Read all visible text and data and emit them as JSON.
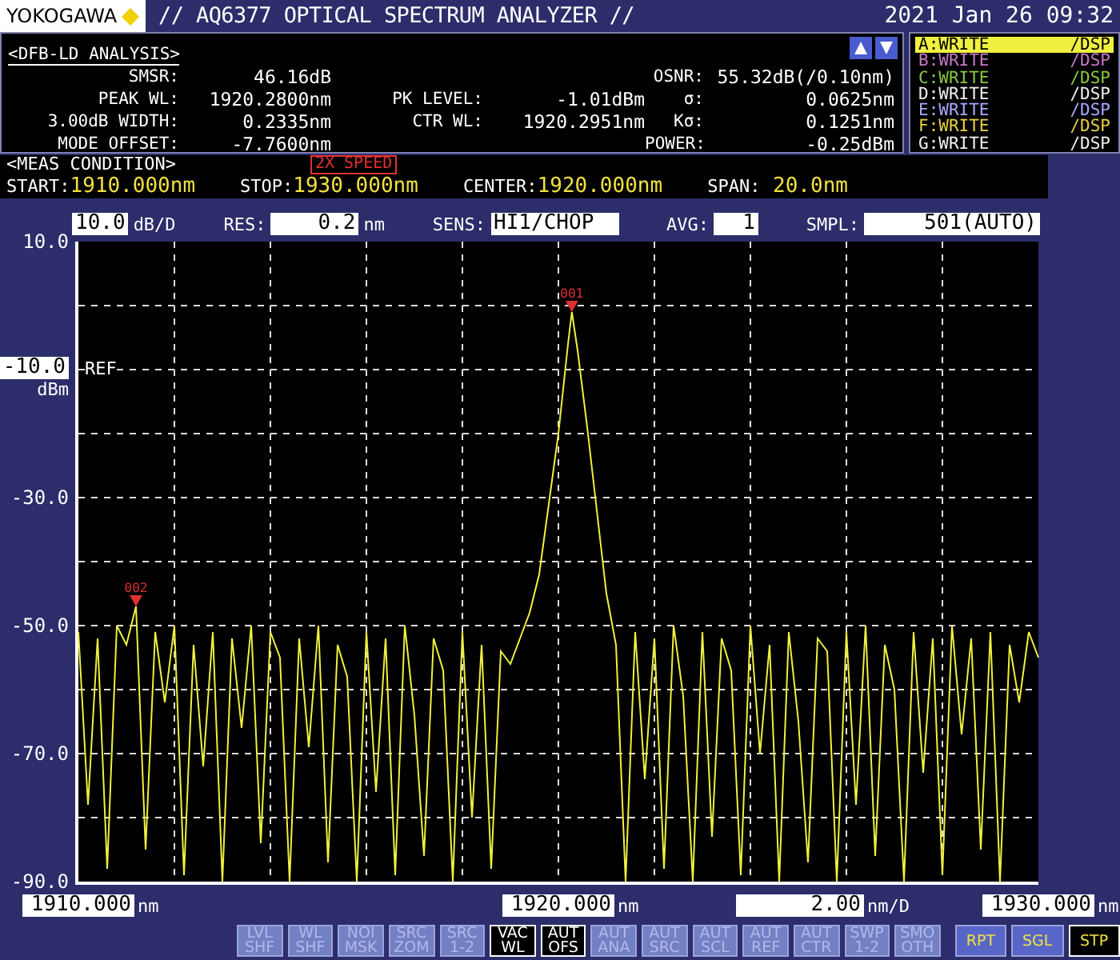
{
  "header": {
    "brand": "YOKOGAWA",
    "title": "// AQ6377 OPTICAL SPECTRUM ANALYZER //",
    "datetime": "2021 Jan 26 09:32"
  },
  "analysis": {
    "title": "<DFB-LD ANALYSIS>",
    "rows": [
      {
        "left": {
          "label": "SMSR:",
          "value": "46.16dB"
        },
        "right": {
          "label": "OSNR:",
          "value": "55.32dB(/0.10nm)"
        }
      },
      {
        "left": {
          "label": "PEAK WL:",
          "value": "1920.2800nm"
        },
        "middle": {
          "label": "PK LEVEL:",
          "value": "-1.01dBm"
        },
        "right": {
          "label": "σ:",
          "value": "0.0625nm"
        }
      },
      {
        "left": {
          "label": "3.00dB WIDTH:",
          "value": "0.2335nm"
        },
        "middle": {
          "label": "CTR WL:",
          "value": "1920.2951nm"
        },
        "right": {
          "label": "Kσ:",
          "value": "0.1251nm"
        }
      },
      {
        "left": {
          "label": "MODE OFFSET:",
          "value": "-7.7600nm"
        },
        "right": {
          "label": "POWER:",
          "value": "-0.25dBm"
        }
      }
    ]
  },
  "traces": [
    {
      "name": "A:WRITE",
      "mode": "/DSP",
      "color": "#f0f040",
      "selected": true
    },
    {
      "name": "B:WRITE",
      "mode": "/DSP",
      "color": "#c878c8",
      "selected": false
    },
    {
      "name": "C:WRITE",
      "mode": "/DSP",
      "color": "#88c840",
      "selected": false
    },
    {
      "name": "D:WRITE",
      "mode": "/DSP",
      "color": "#f0f0f0",
      "selected": false
    },
    {
      "name": "E:WRITE",
      "mode": "/DSP",
      "color": "#a8a8ff",
      "selected": false
    },
    {
      "name": "F:WRITE",
      "mode": "/DSP",
      "color": "#e8d040",
      "selected": false
    },
    {
      "name": "G:WRITE",
      "mode": "/DSP",
      "color": "#f0f0f0",
      "selected": false
    }
  ],
  "meas_condition": {
    "title": "<MEAS CONDITION>",
    "badge": "2X SPEED",
    "items": [
      {
        "label": "START:",
        "value": "1910.000nm"
      },
      {
        "label": "STOP:",
        "value": "1930.000nm"
      },
      {
        "label": "CENTER:",
        "value": "1920.000nm"
      },
      {
        "label": "SPAN:",
        "value": " 20.0nm"
      }
    ]
  },
  "settings": [
    {
      "value": "10.0",
      "unit": "dB/D"
    },
    {
      "label": "RES:",
      "value": "0.2",
      "unit": "nm"
    },
    {
      "label": "SENS:",
      "value": "HI1/CHOP"
    },
    {
      "label": "AVG:",
      "value": "1"
    },
    {
      "label": "SMPL:",
      "value": "501(AUTO)"
    }
  ],
  "plot": {
    "ref": {
      "text": "-10.0",
      "unit": "dBm",
      "tag": "REF"
    },
    "markers": [
      {
        "label": "001"
      },
      {
        "label": "002"
      }
    ],
    "chart_data": {
      "type": "line",
      "grid": true,
      "xlim": [
        1910,
        1930
      ],
      "ylim": [
        -90,
        10
      ],
      "xticks": [
        {
          "value": 1910,
          "label": "1910.000"
        },
        {
          "value": 1920,
          "label": "1920.000"
        },
        {
          "value": 1930,
          "label": "1930.000"
        }
      ],
      "yticks": [
        {
          "value": 10,
          "label": "10.0"
        },
        {
          "value": -30,
          "label": "-30.0"
        },
        {
          "value": -50,
          "label": "-50.0"
        },
        {
          "value": -70,
          "label": "-70.0"
        },
        {
          "value": -90,
          "label": "-90.0"
        }
      ],
      "x": [
        1910.0,
        1910.2,
        1910.4,
        1910.6,
        1910.8,
        1911.0,
        1911.2,
        1911.4,
        1911.6,
        1911.8,
        1912.0,
        1912.2,
        1912.4,
        1912.6,
        1912.8,
        1913.0,
        1913.2,
        1913.4,
        1913.6,
        1913.8,
        1914.0,
        1914.2,
        1914.4,
        1914.6,
        1914.8,
        1915.0,
        1915.2,
        1915.4,
        1915.6,
        1915.8,
        1916.0,
        1916.2,
        1916.4,
        1916.6,
        1916.8,
        1917.0,
        1917.2,
        1917.4,
        1917.6,
        1917.8,
        1918.0,
        1918.2,
        1918.4,
        1918.6,
        1918.8,
        1919.0,
        1919.2,
        1919.4,
        1919.6,
        1919.8,
        1920.0,
        1920.2,
        1920.28,
        1920.4,
        1920.6,
        1920.8,
        1921.0,
        1921.2,
        1921.4,
        1921.6,
        1921.8,
        1922.0,
        1922.2,
        1922.4,
        1922.6,
        1922.8,
        1923.0,
        1923.2,
        1923.4,
        1923.6,
        1923.8,
        1924.0,
        1924.2,
        1924.4,
        1924.6,
        1924.8,
        1925.0,
        1925.2,
        1925.4,
        1925.6,
        1925.8,
        1926.0,
        1926.2,
        1926.4,
        1926.6,
        1926.8,
        1927.0,
        1927.2,
        1927.4,
        1927.6,
        1927.8,
        1928.0,
        1928.2,
        1928.4,
        1928.6,
        1928.8,
        1929.0,
        1929.2,
        1929.4,
        1929.6,
        1929.8,
        1930.0
      ],
      "values": [
        -51,
        -78,
        -52,
        -88,
        -50,
        -53,
        -47,
        -85,
        -51,
        -62,
        -50,
        -89,
        -53,
        -72,
        -51,
        -90,
        -52,
        -66,
        -50,
        -84,
        -51,
        -55,
        -90,
        -52,
        -69,
        -50,
        -87,
        -53,
        -58,
        -90,
        -51,
        -76,
        -52,
        -89,
        -50,
        -64,
        -86,
        -52,
        -57,
        -90,
        -51,
        -80,
        -53,
        -88,
        -54,
        -56,
        -52,
        -48,
        -42,
        -31,
        -20,
        -6,
        -1,
        -7,
        -19,
        -32,
        -45,
        -53,
        -90,
        -51,
        -74,
        -52,
        -88,
        -50,
        -61,
        -90,
        -51,
        -83,
        -52,
        -57,
        -89,
        -50,
        -70,
        -53,
        -90,
        -51,
        -65,
        -87,
        -52,
        -54,
        -90,
        -51,
        -78,
        -50,
        -86,
        -53,
        -60,
        -90,
        -51,
        -73,
        -52,
        -89,
        -50,
        -67,
        -52,
        -85,
        -51,
        -90,
        -53,
        -62,
        -51,
        -55
      ]
    }
  },
  "x_fields": [
    {
      "kind": "tick",
      "unit": "nm"
    },
    {
      "kind": "tick",
      "unit": "nm"
    },
    {
      "kind": "scale",
      "value": "2.00",
      "unit": "nm/D"
    },
    {
      "kind": "tick",
      "unit": "nm"
    }
  ],
  "softkeys": [
    {
      "kind": "soft",
      "lines": [
        "LVL",
        "SHF"
      ],
      "selected": false
    },
    {
      "kind": "soft",
      "lines": [
        "WL",
        "SHF"
      ],
      "selected": false
    },
    {
      "kind": "soft",
      "lines": [
        "NOI",
        "MSK"
      ],
      "selected": false
    },
    {
      "kind": "soft",
      "lines": [
        "SRC",
        "ZOM"
      ],
      "selected": false
    },
    {
      "kind": "soft",
      "lines": [
        "SRC",
        "1-2"
      ],
      "selected": false
    },
    {
      "kind": "soft",
      "lines": [
        "VAC",
        "WL"
      ],
      "selected": true
    },
    {
      "kind": "soft",
      "lines": [
        "AUT",
        "OFS"
      ],
      "selected": true
    },
    {
      "kind": "soft",
      "lines": [
        "AUT",
        "ANA"
      ],
      "selected": false
    },
    {
      "kind": "soft",
      "lines": [
        "AUT",
        "SRC"
      ],
      "selected": false
    },
    {
      "kind": "soft",
      "lines": [
        "AUT",
        "SCL"
      ],
      "selected": false
    },
    {
      "kind": "soft",
      "lines": [
        "AUT",
        "REF"
      ],
      "selected": false
    },
    {
      "kind": "soft",
      "lines": [
        "AUT",
        "CTR"
      ],
      "selected": false
    },
    {
      "kind": "soft",
      "lines": [
        "SWP",
        "1-2"
      ],
      "selected": false
    },
    {
      "kind": "soft",
      "lines": [
        "SMO",
        "OTH"
      ],
      "selected": false
    },
    {
      "kind": "sweep",
      "lines": [
        "RPT"
      ],
      "selected": false
    },
    {
      "kind": "sweep",
      "lines": [
        "SGL"
      ],
      "selected": false
    },
    {
      "kind": "sweep",
      "lines": [
        "STP"
      ],
      "selected": true
    }
  ]
}
